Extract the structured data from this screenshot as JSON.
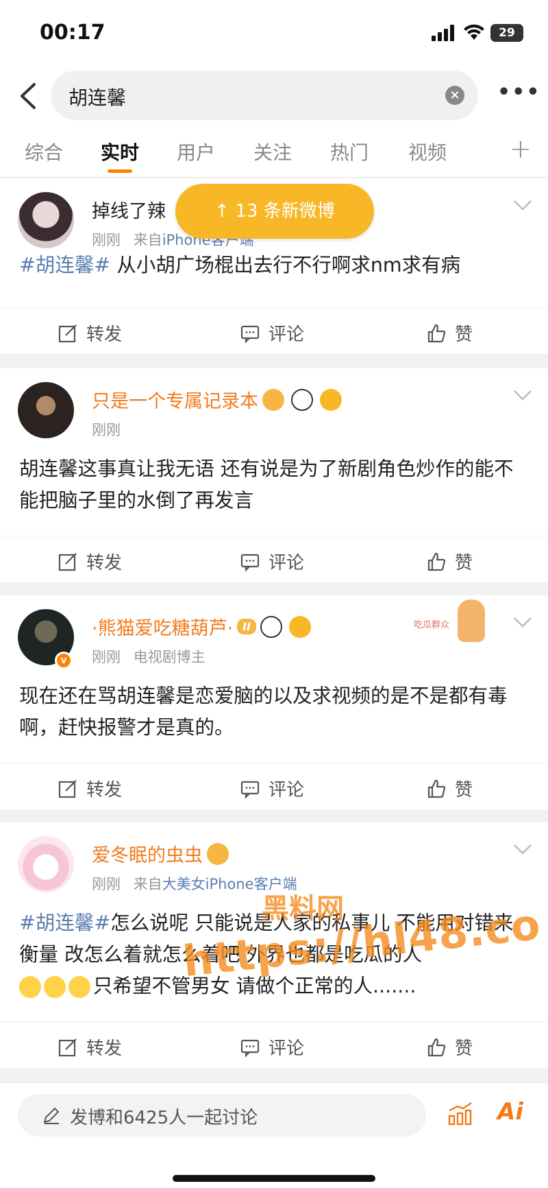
{
  "status_bar": {
    "time": "00:17",
    "battery": "29"
  },
  "search": {
    "query": "胡连馨"
  },
  "tabs": [
    {
      "label": "综合"
    },
    {
      "label": "实时"
    },
    {
      "label": "用户"
    },
    {
      "label": "关注"
    },
    {
      "label": "热门"
    },
    {
      "label": "视频"
    }
  ],
  "new_posts_pill": "↑ 13 条新微博",
  "posts": [
    {
      "username": "掉线了辣",
      "time": "刚刚",
      "source_prefix": "来自",
      "source": "iPhone客户端",
      "tag": "#胡连馨#",
      "content": " 从小胡广场棍出去行不行啊求nm求有病",
      "repost": "转发",
      "comment": "评论",
      "like": "赞"
    },
    {
      "username": "只是一个专属记录本",
      "time": "刚刚",
      "content": "胡连馨这事真让我无语 还有说是为了新剧角色炒作的能不能把脑子里的水倒了再发言",
      "repost": "转发",
      "comment": "评论",
      "like": "赞"
    },
    {
      "username": "·熊猫爱吃糖葫芦·",
      "time": "刚刚",
      "source": "电视剧博主",
      "level_badge": "II",
      "sticker": "吃瓜群众",
      "content": "现在还在骂胡连馨是恋爱脑的以及求视频的是不是都有毒啊，赶快报警才是真的。",
      "repost": "转发",
      "comment": "评论",
      "like": "赞"
    },
    {
      "username": "爱冬眠的虫虫",
      "time": "刚刚",
      "source_prefix": "来自",
      "source": "大美女iPhone客户端",
      "tag": "#胡连馨#",
      "content": "怎么说呢 只能说是人家的私事儿 不能用对错来衡量 改怎么着就怎么着吧 外界也都是吃瓜的人",
      "content_tail": "只希望不管男女 请做个正常的人.......",
      "repost": "转发",
      "comment": "评论",
      "like": "赞"
    }
  ],
  "watermark": {
    "cn": "黑料网",
    "url": "https://hl48.co"
  },
  "bottom_bar": {
    "compose_placeholder": "发博和6425人一起讨论",
    "ai_label": "Ai"
  },
  "colors": {
    "accent": "#ff8200",
    "link": "#5a7eb0",
    "pill": "#f7b726",
    "vip_name": "#f27b1d"
  }
}
